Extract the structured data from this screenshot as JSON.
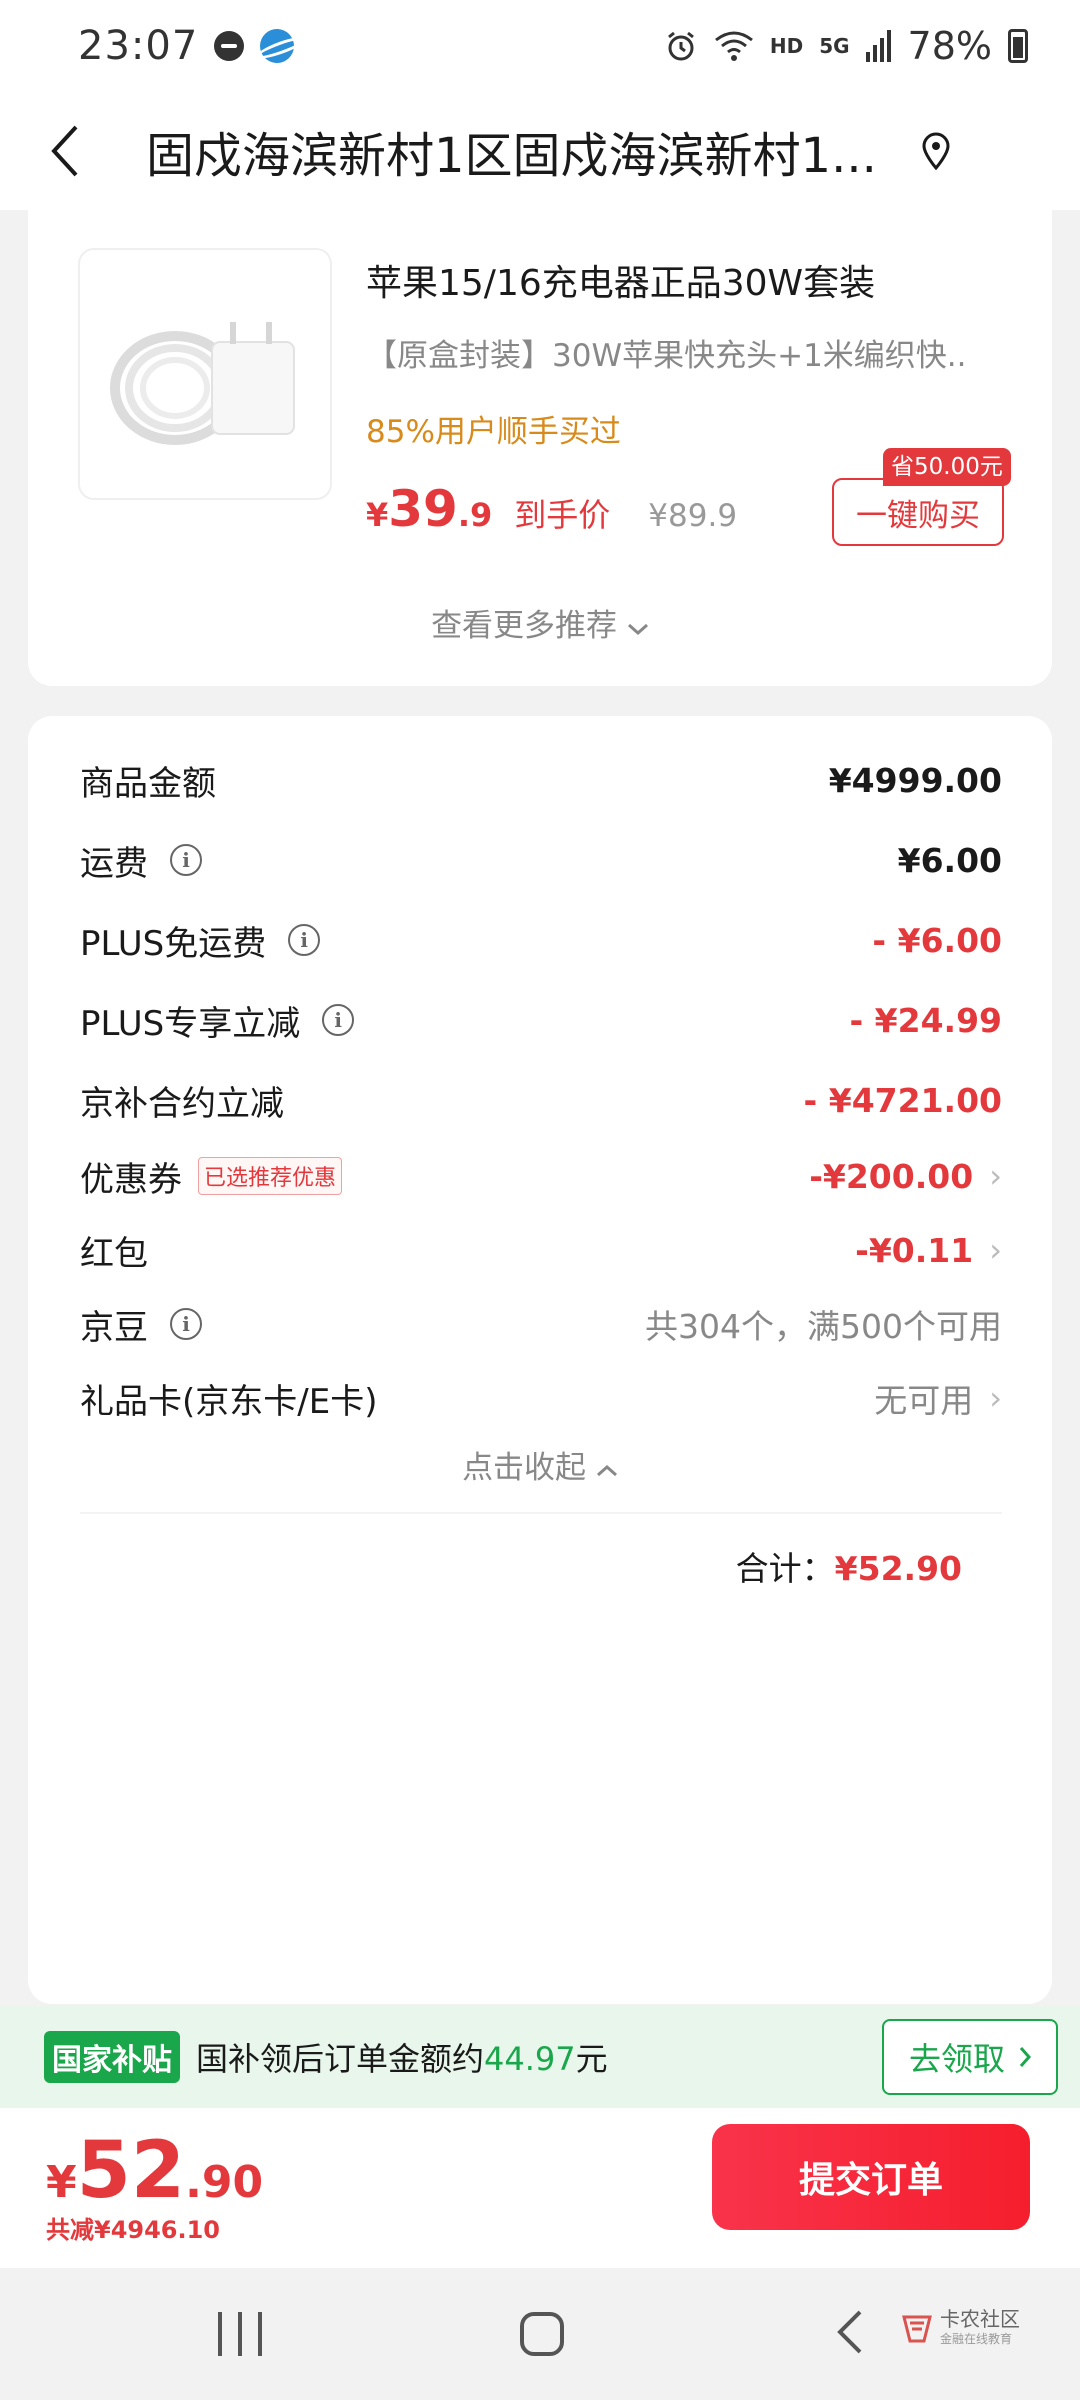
{
  "status_bar": {
    "time": "23:07",
    "hd": "HD",
    "network": "5G",
    "battery": "78%"
  },
  "header": {
    "address": "固戍海滨新村1区固戍海滨新村1..."
  },
  "recommend": {
    "product_title": "苹果15/16充电器正品30W套装",
    "product_desc": "【原盒封装】30W苹果快充头+1米编织快...",
    "social_proof": "85%用户顺手买过",
    "price_yen": "¥",
    "price_int": "39",
    "price_dec": ".9",
    "price_label": "到手价",
    "original_price": "¥89.9",
    "save_badge": "省50.00元",
    "buy_button": "一键购买",
    "more_label": "查看更多推荐"
  },
  "fees": {
    "items": [
      {
        "label": "商品金额",
        "value": "¥4999.00"
      },
      {
        "label": "运费",
        "value": "¥6.00"
      },
      {
        "label": "PLUS免运费",
        "value": "- ¥6.00"
      },
      {
        "label": "PLUS专享立减",
        "value": "- ¥24.99"
      },
      {
        "label": "京补合约立减",
        "value": "- ¥4721.00"
      },
      {
        "label": "优惠券",
        "tag": "已选推荐优惠",
        "value": "-¥200.00"
      },
      {
        "label": "红包",
        "value": "-¥0.11"
      },
      {
        "label": "京豆",
        "value": "共304个，满500个可用"
      },
      {
        "label": "礼品卡(京东卡/E卡)",
        "value": "无可用"
      }
    ],
    "collapse_label": "点击收起",
    "total_label": "合计：",
    "total_value": "¥52.90"
  },
  "subsidy": {
    "tag": "国家补贴",
    "text_before": "国补领后订单金额约",
    "amount": "44.97",
    "text_after": "元",
    "button": "去领取"
  },
  "checkout": {
    "yen": "¥",
    "int": "52",
    "dec": ".90",
    "saved": "共减¥4946.10",
    "submit": "提交订单"
  },
  "watermark": {
    "name": "卡农社区",
    "sub": "金融在线教育"
  },
  "colors": {
    "accent_red": "#e4393c",
    "subsidy_green": "#1aa64b",
    "social_orange": "#d88a1a"
  }
}
